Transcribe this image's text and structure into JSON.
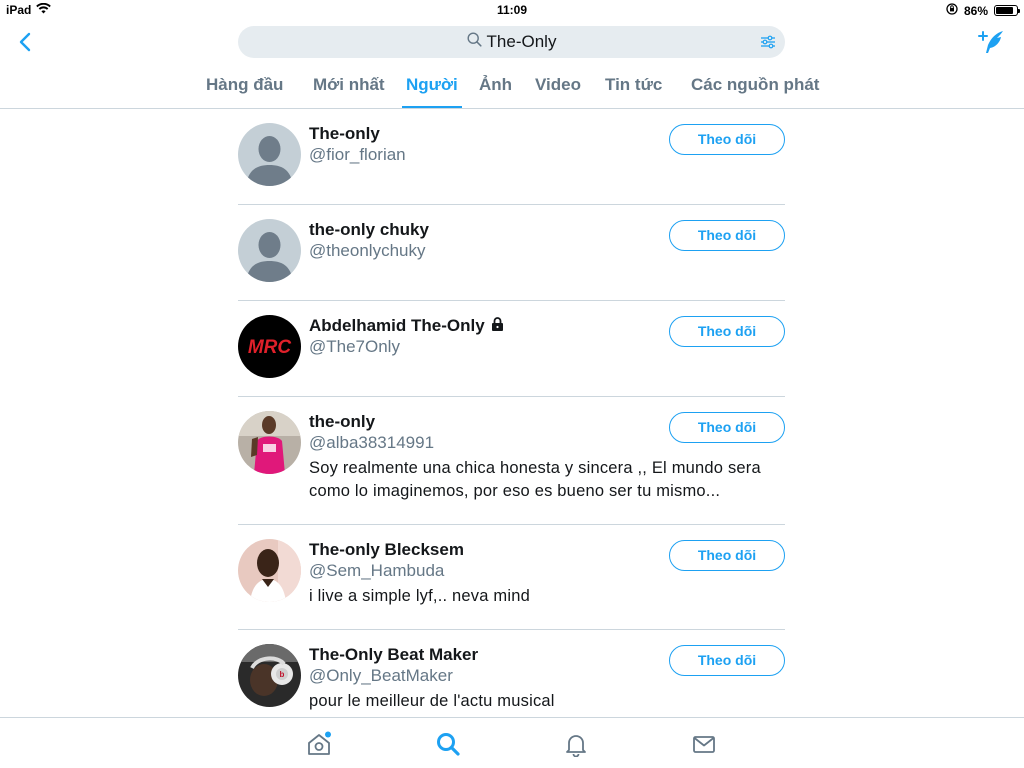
{
  "status_bar": {
    "device": "iPad",
    "time": "11:09",
    "battery": "86%",
    "battery_level": 0.86,
    "icons": [
      "wifi-icon",
      "orientation-lock-icon",
      "battery-icon"
    ]
  },
  "header": {
    "back_icon": "chevron-left-icon",
    "search": {
      "value": "The-Only",
      "icon": "search-icon"
    },
    "filter_icon": "filter-sliders-icon",
    "compose_icon": "compose-tweet-icon"
  },
  "tabs": [
    {
      "label": "Hàng đầu"
    },
    {
      "label": "Mới nhất"
    },
    {
      "label": "Người",
      "active": true
    },
    {
      "label": "Ảnh"
    },
    {
      "label": "Video"
    },
    {
      "label": "Tin tức"
    },
    {
      "label": "Các nguồn phát"
    }
  ],
  "users": [
    {
      "name": "The-only",
      "handle": "@fior_florian",
      "bio": "",
      "follow_label": "Theo dõi",
      "avatar": "default-avatar"
    },
    {
      "name": "the-only chuky",
      "handle": "@theonlychuky",
      "bio": "",
      "follow_label": "Theo dõi",
      "avatar": "default-avatar"
    },
    {
      "name": "Abdelhamid The-Only",
      "handle": "@The7Only",
      "bio": "",
      "follow_label": "Theo dõi",
      "protected": true,
      "avatar": "mrc-logo-avatar",
      "avatar_text": "MRC"
    },
    {
      "name": "the-only",
      "handle": "@alba38314991",
      "bio": "Soy realmente una chica honesta y sincera ,, El mundo sera como lo imaginemos, por eso es bueno ser tu mismo...",
      "follow_label": "Theo dõi",
      "avatar": "photo-avatar"
    },
    {
      "name": "The-only Blecksem",
      "handle": "@Sem_Hambuda",
      "bio": "i live a simple lyf,.. neva mind",
      "follow_label": "Theo dõi",
      "avatar": "photo-avatar"
    },
    {
      "name": "The-Only Beat Maker",
      "handle": "@Only_BeatMaker",
      "bio": "pour le meilleur de l'actu musical",
      "follow_label": "Theo dõi",
      "avatar": "photo-avatar"
    }
  ],
  "bottom_bar": {
    "items": [
      {
        "icon": "home-icon",
        "has_notification_dot": true
      },
      {
        "icon": "search-icon",
        "active": true
      },
      {
        "icon": "notifications-bell-icon"
      },
      {
        "icon": "messages-envelope-icon"
      }
    ]
  },
  "colors": {
    "accent": "#1da1f2",
    "secondary_text": "#657786",
    "primary_text": "#14171a",
    "search_bg": "#e6ecf0",
    "divider": "#ccd6dd"
  }
}
